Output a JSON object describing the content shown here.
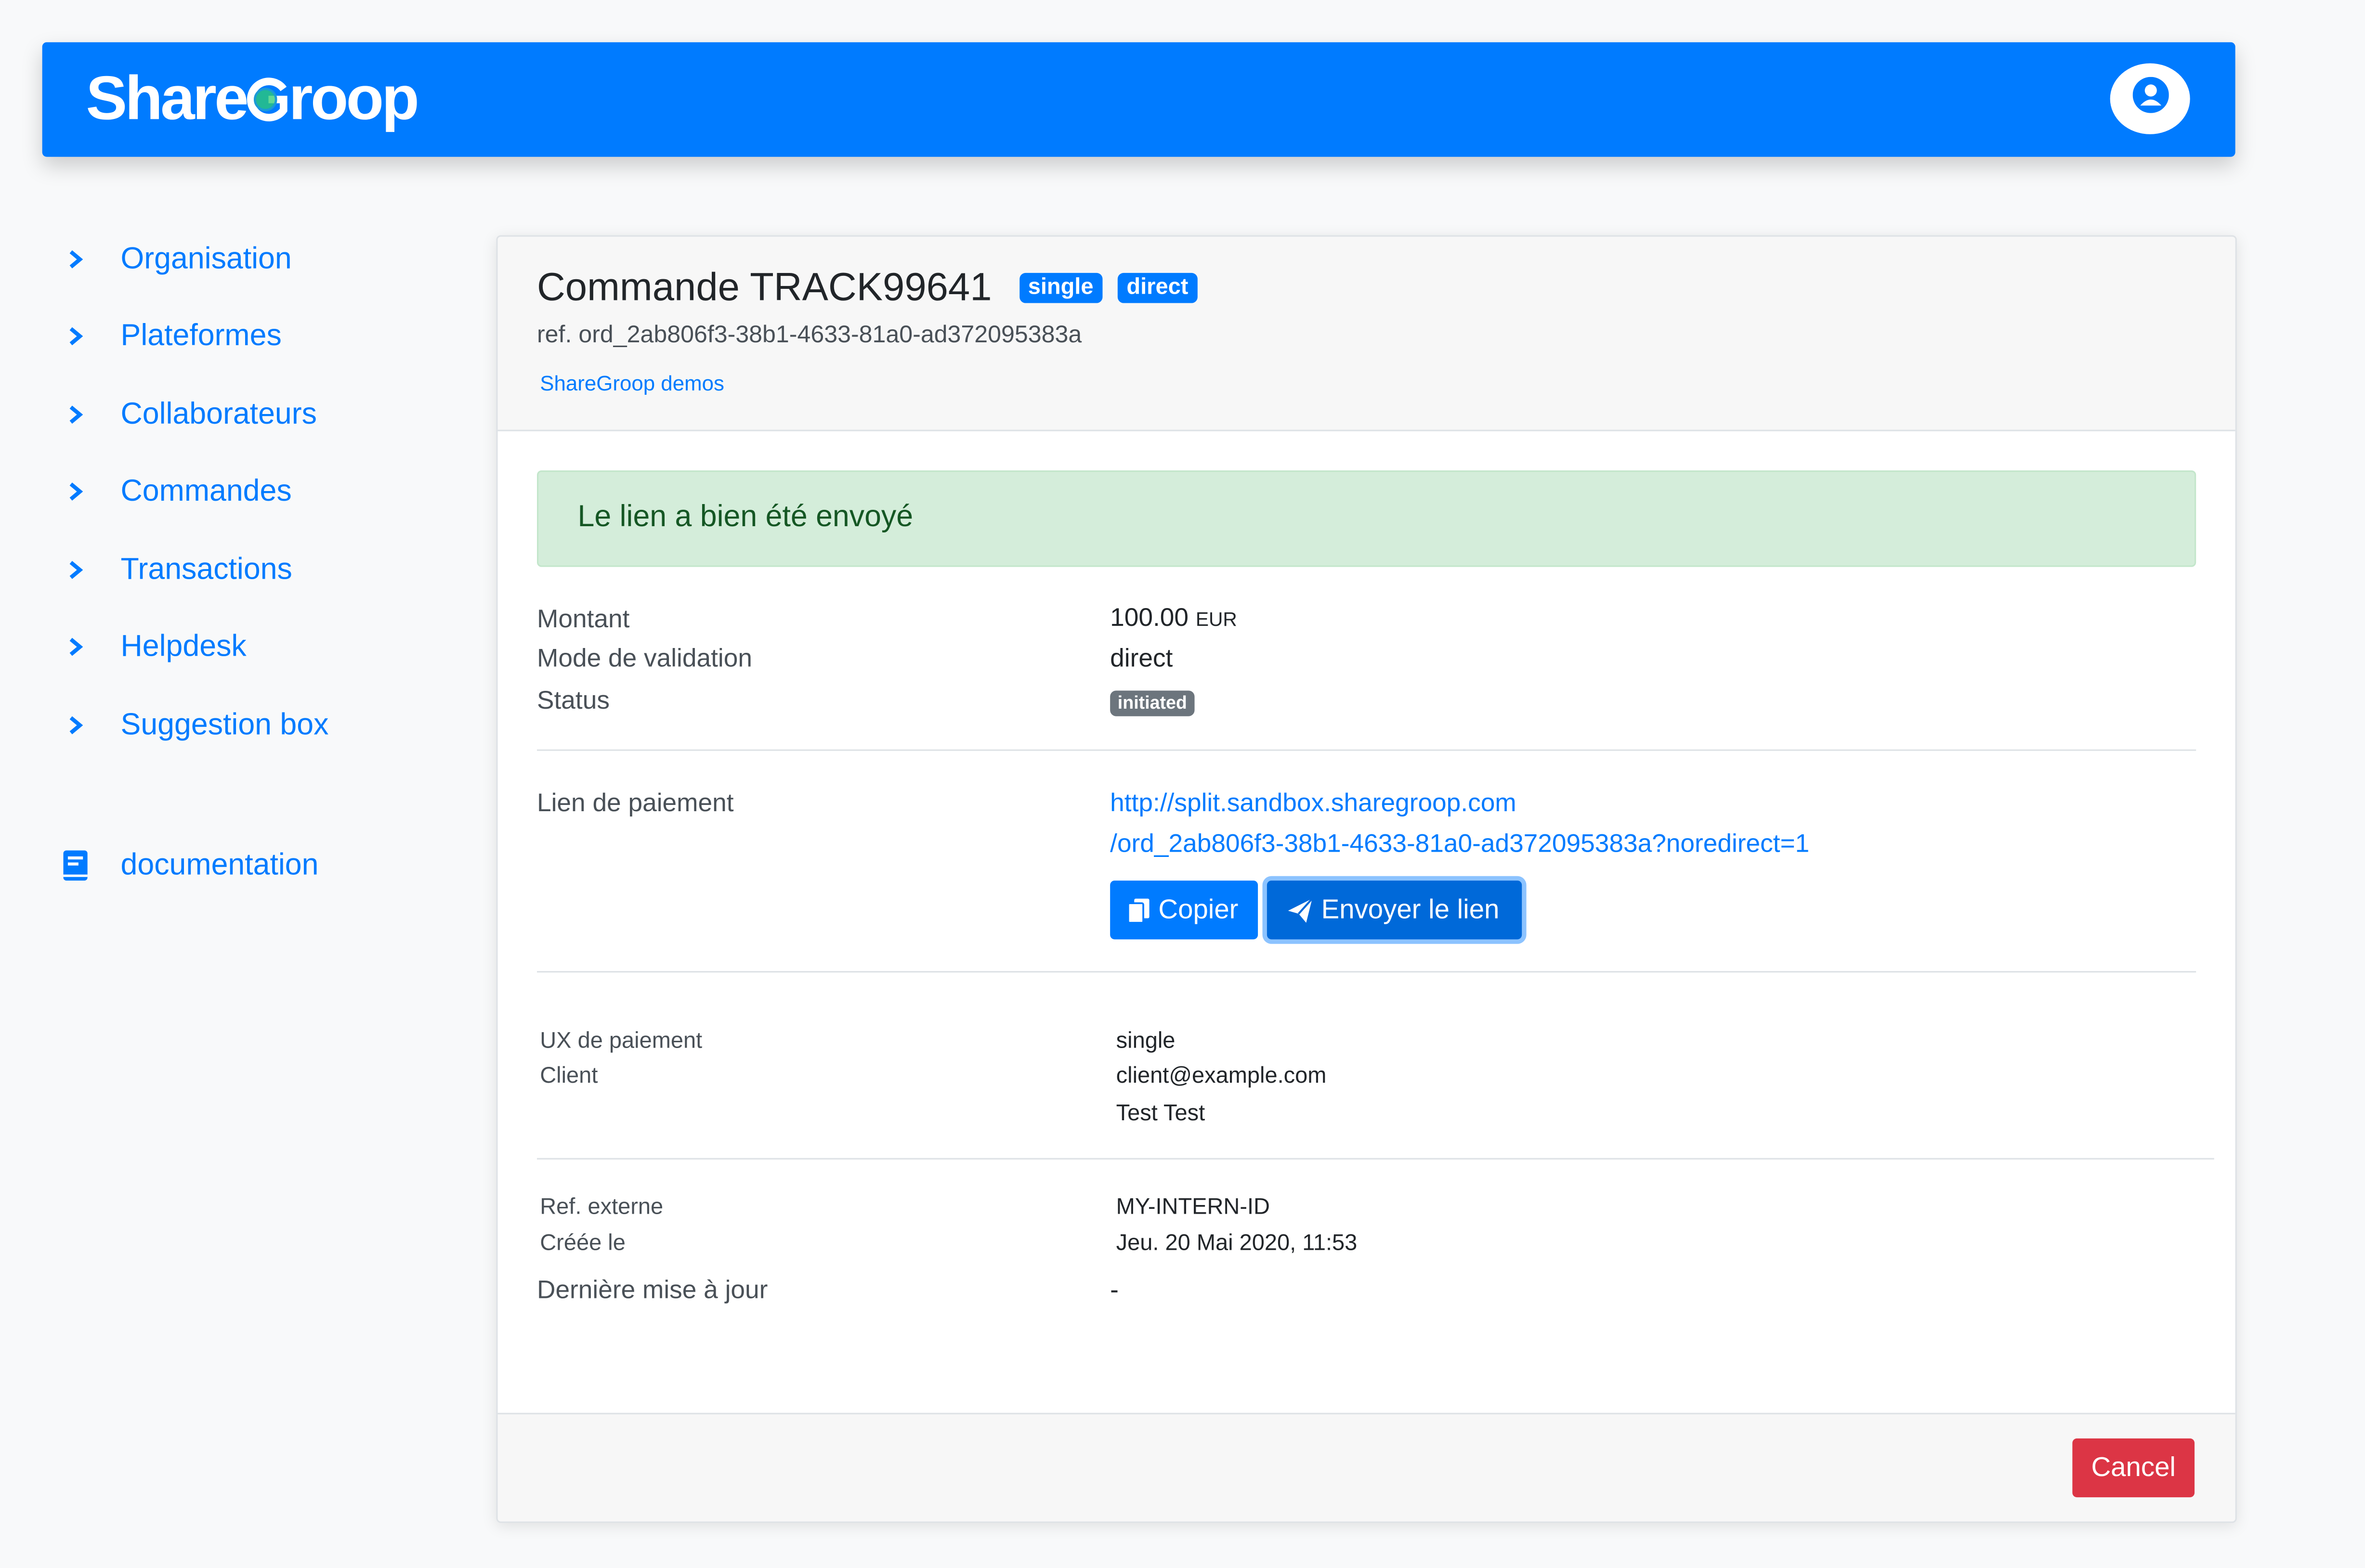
{
  "header": {
    "logo_before": "Share",
    "logo_after": "roop",
    "brand_color": "#007bff"
  },
  "sidebar": {
    "items": [
      {
        "label": "Organisation",
        "icon": "chevron-right-icon"
      },
      {
        "label": "Plateformes",
        "icon": "chevron-right-icon"
      },
      {
        "label": "Collaborateurs",
        "icon": "chevron-right-icon"
      },
      {
        "label": "Commandes",
        "icon": "chevron-right-icon"
      },
      {
        "label": "Transactions",
        "icon": "chevron-right-icon"
      },
      {
        "label": "Helpdesk",
        "icon": "chevron-right-icon"
      },
      {
        "label": "Suggestion box",
        "icon": "chevron-right-icon"
      }
    ],
    "documentation": {
      "label": "documentation",
      "icon": "book-icon"
    }
  },
  "order": {
    "title": "Commande TRACK99641",
    "badges": [
      "single",
      "direct"
    ],
    "ref": "ref. ord_2ab806f3-38b1-4633-81a0-ad372095383a",
    "organization_link": "ShareGroop demos",
    "alert": "Le lien a bien été envoyé",
    "summary": {
      "amount_label": "Montant",
      "amount_value": "100.00",
      "amount_currency": "EUR",
      "validation_label": "Mode de validation",
      "validation_value": "direct",
      "status_label": "Status",
      "status_value": "initiated"
    },
    "payment": {
      "label": "Lien de paiement",
      "link_line1": "http://split.sandbox.sharegroop.com",
      "link_line2": "/ord_2ab806f3-38b1-4633-81a0-ad372095383a?noredirect=1",
      "copy_button": "Copier",
      "send_button": "Envoyer le lien"
    },
    "details": {
      "ux_label": "UX de paiement",
      "ux_value": "single",
      "client_label": "Client",
      "client_email": "client@example.com",
      "client_name": "Test Test"
    },
    "meta": {
      "external_ref_label": "Ref. externe",
      "external_ref_value": "MY-INTERN-ID",
      "created_label": "Créée le",
      "created_value": "Jeu. 20 Mai 2020, 11:53",
      "updated_label": "Dernière mise à jour",
      "updated_value": "-"
    },
    "cancel_button": "Cancel",
    "colors": {
      "success_bg": "#d4edda",
      "success_text": "#155724",
      "danger": "#dc3545",
      "secondary": "#6c757d"
    }
  }
}
